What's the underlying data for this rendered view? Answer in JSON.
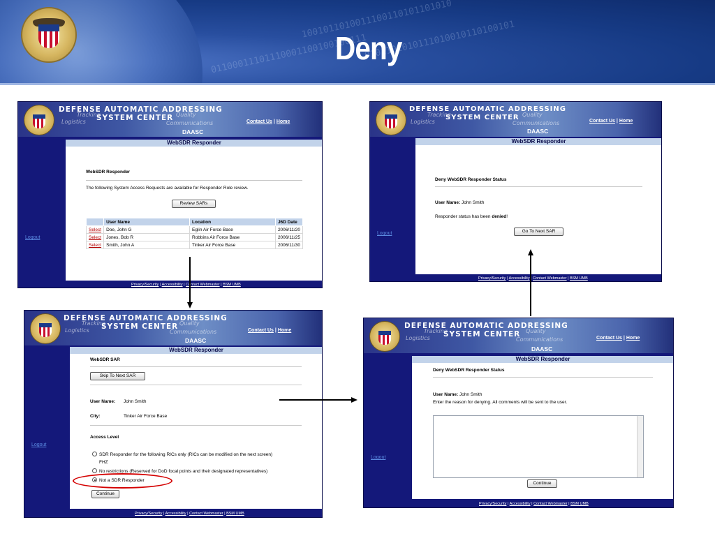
{
  "slide": {
    "title": "Deny"
  },
  "site": {
    "line1": "DEFENSE  AUTOMATIC  ADDRESSING",
    "line2": "SYSTEM  CENTER",
    "tracking": "Tracking",
    "logistics": "Logistics",
    "quality": "Quality",
    "communications": "Communications",
    "contact": "Contact Us",
    "sep": "|",
    "home": "Home",
    "daasc": "DAASC",
    "app_bar": "WebSDR Responder",
    "logout": "Logout",
    "footer": {
      "privacy": "Privacy/Security",
      "accessibility": "Accessibility",
      "webmaster": "Contact Webmaster",
      "bsm": "BSM UMB",
      "sep": " | "
    }
  },
  "screen1": {
    "heading": "WebSDR Responder",
    "intro": "The following System Access Requests are available for Responder Role review.",
    "review_button": "Review SARs",
    "columns": [
      "",
      "User Name",
      "Location",
      "J6D Date"
    ],
    "rows": [
      {
        "action": "Select",
        "user": "Doe, John G",
        "location": "Eglin Air Force Base",
        "date": "2006/11/20"
      },
      {
        "action": "Select",
        "user": "Jones, Bob R",
        "location": "Robbins Air Force Base",
        "date": "2006/11/25"
      },
      {
        "action": "Select",
        "user": "Smith, John A",
        "location": "Tinker Air Force Base",
        "date": "2006/11/30"
      }
    ]
  },
  "screen2": {
    "heading": "Deny WebSDR Responder Status",
    "user_label": "User Name:",
    "user_value": "John Smith",
    "message_prefix": "Responder status has been ",
    "message_bold": "denied",
    "message_suffix": "!",
    "next_button": "Go To Next SAR"
  },
  "screen3": {
    "heading": "WebSDR SAR",
    "skip_button": "Skip To Next SAR",
    "user_label": "User Name:",
    "user_value": "John Smith",
    "city_label": "City:",
    "city_value": "Tinker Air Force Base",
    "access_heading": "Access Level",
    "options": [
      "SDR Responder for the following RICs only (RICs can be modified on the next screen)",
      "No restrictions (Reserved for DoD focal points and their designated representatives)",
      "Not a SDR Responder"
    ],
    "ric": "FHZ",
    "selected_option": "Not a SDR Responder",
    "continue_button": "Continue"
  },
  "screen4": {
    "heading": "Deny WebSDR Responder Status",
    "user_label": "User Name:",
    "user_value": "John Smith",
    "instructions": "Enter the reason for denying. All comments will be sent to the user.",
    "comment_value": "",
    "continue_button": "Continue"
  }
}
